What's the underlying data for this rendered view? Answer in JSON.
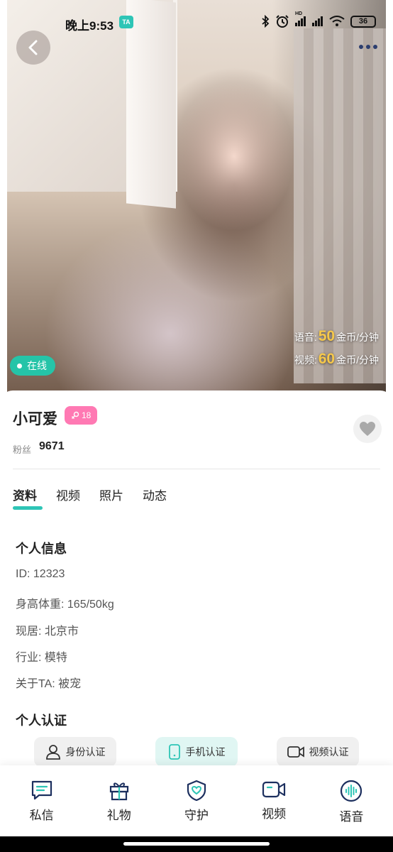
{
  "status_bar": {
    "time": "晚上9:53",
    "app_icon": "TA",
    "hd": "HD",
    "battery": "36"
  },
  "profile": {
    "online": "在线",
    "pricing": {
      "voice_label": "语音:",
      "voice_value": "50",
      "voice_unit": "金币/分钟",
      "video_label": "视频:",
      "video_value": "60",
      "video_unit": "金币/分钟"
    },
    "name": "小可爱",
    "age": "18",
    "fans_label": "粉丝",
    "fans_value": "9671"
  },
  "tabs": [
    {
      "label": "资料",
      "active": true
    },
    {
      "label": "视频",
      "active": false
    },
    {
      "label": "照片",
      "active": false
    },
    {
      "label": "动态",
      "active": false
    }
  ],
  "personal_info": {
    "title": "个人信息",
    "lines": [
      "ID: 12323",
      "身高体重: 165/50kg",
      "现居: 北京市",
      "行业: 模特",
      "关于TA: 被宠"
    ]
  },
  "verification": {
    "title": "个人认证",
    "items": [
      {
        "label": "身份认证",
        "icon": "person-icon"
      },
      {
        "label": "手机认证",
        "icon": "phone-icon"
      },
      {
        "label": "视频认证",
        "icon": "video-camera-icon"
      }
    ]
  },
  "bottom_bar": [
    {
      "label": "私信",
      "icon": "message-icon"
    },
    {
      "label": "礼物",
      "icon": "gift-icon"
    },
    {
      "label": "守护",
      "icon": "guard-shield-icon"
    },
    {
      "label": "视频",
      "icon": "video-icon"
    },
    {
      "label": "语音",
      "icon": "voice-icon"
    }
  ],
  "colors": {
    "accent": "#2ec5b6",
    "online": "#25c4a8",
    "price": "#f6c84a",
    "age_badge": "#ff79b3"
  }
}
